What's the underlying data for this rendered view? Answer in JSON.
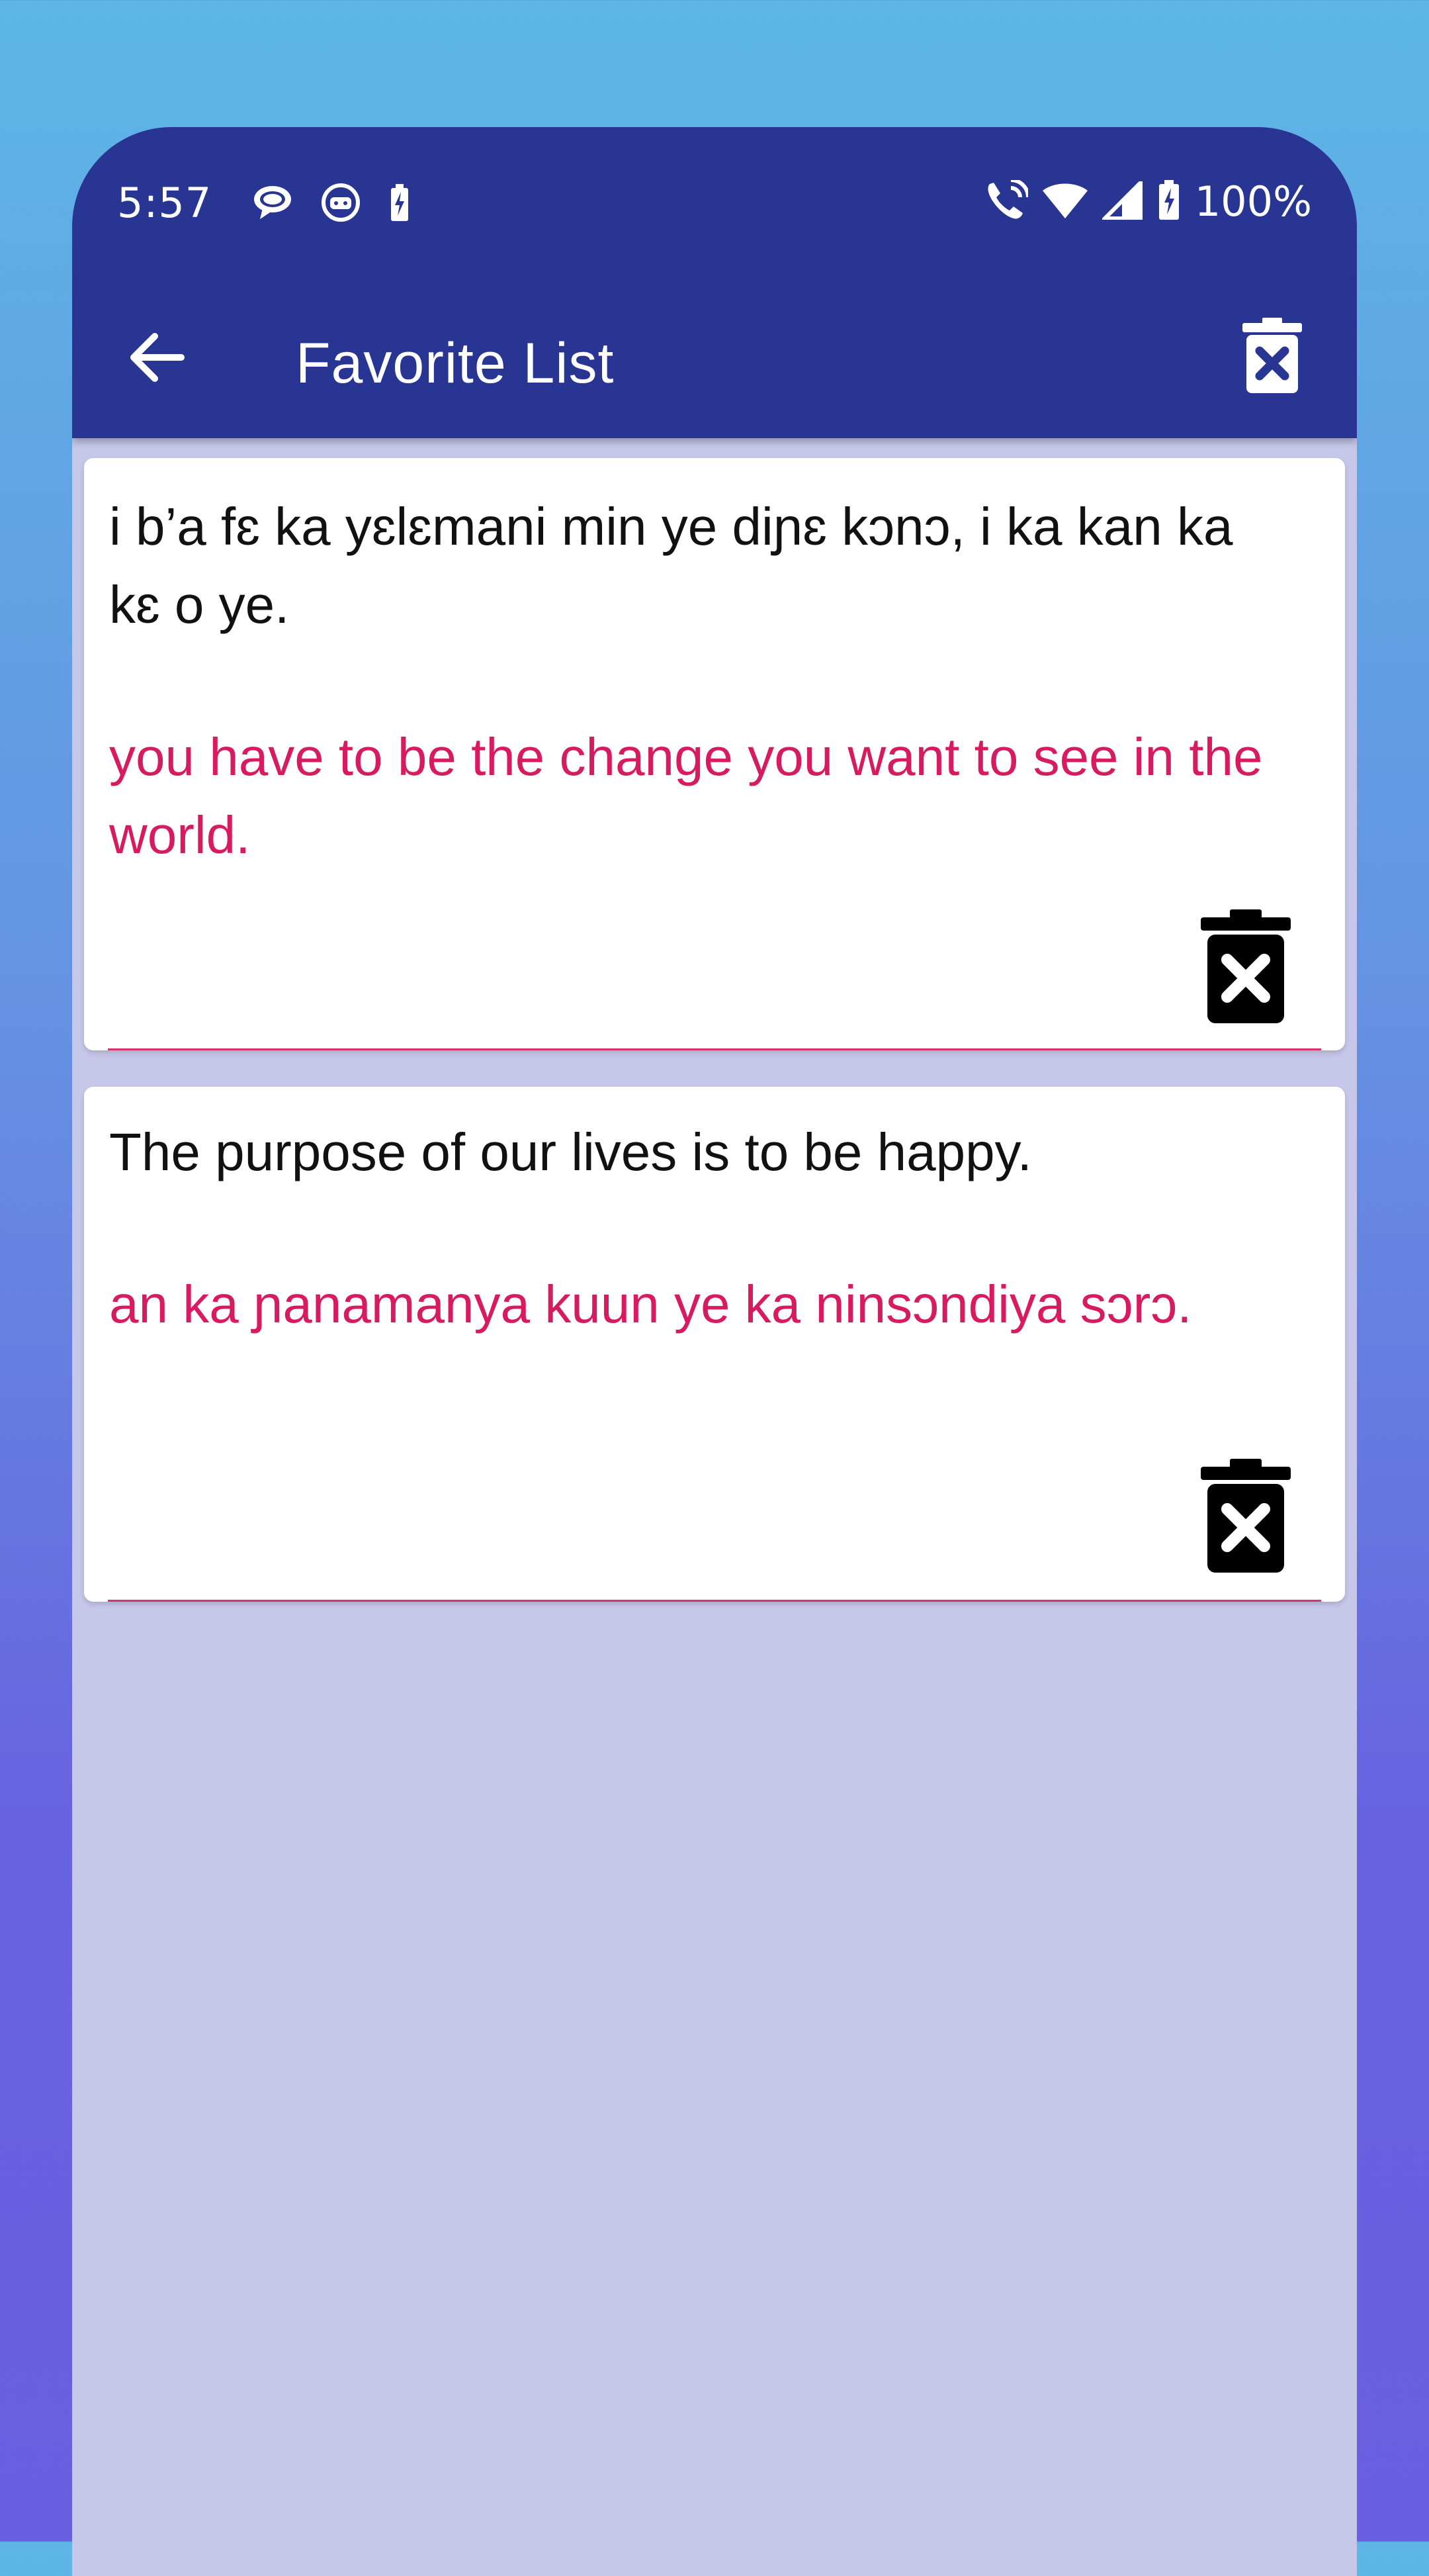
{
  "status_bar": {
    "time": "5:57",
    "battery": "100%"
  },
  "app_bar": {
    "title": "Favorite List"
  },
  "favorites": [
    {
      "source": "i b’a fɛ ka yɛlɛmani min ye diɲɛ kɔnɔ, i ka kan ka kɛ o ye.",
      "translation": "you have to be the change you want to see in the world."
    },
    {
      "source": "The purpose of our lives is to be happy.",
      "translation": "an ka ɲanamanya kuun ye ka ninsɔndiya sɔrɔ."
    }
  ],
  "colors": {
    "app_bar": "#283593",
    "accent": "#d81b60",
    "list_background": "#c7c7ea"
  },
  "icons": {
    "back": "arrow-back-icon",
    "delete_all": "delete-forever-icon",
    "delete_item": "delete-forever-icon"
  }
}
